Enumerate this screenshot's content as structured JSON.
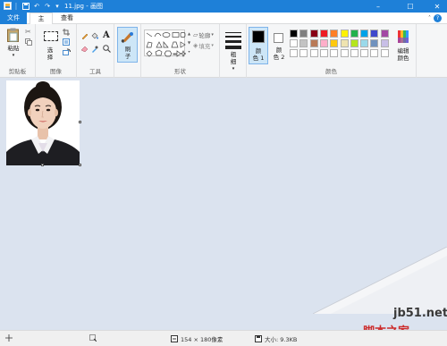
{
  "window": {
    "title": "11.jpg - 画图"
  },
  "tabs": {
    "file": "文件",
    "home": "主页",
    "view": "查看"
  },
  "ribbon": {
    "clipboard": {
      "paste_label": "粘贴",
      "group_label": "剪贴板"
    },
    "image": {
      "select_label_1": "选",
      "select_label_2": "择",
      "group_label": "图像"
    },
    "tools": {
      "text_tool_glyph": "A",
      "group_label": "工具"
    },
    "brushes": {
      "label_1": "刷",
      "label_2": "子"
    },
    "shapes": {
      "outline_label": "轮廓",
      "fill_label": "填充",
      "group_label": "形状"
    },
    "size": {
      "label_1": "粗",
      "label_2": "细"
    },
    "colors": {
      "color1_label_1": "颜",
      "color1_label_2": "色 1",
      "color2_label_1": "颜",
      "color2_label_2": "色 2",
      "edit_label_1": "编辑",
      "edit_label_2": "颜色",
      "group_label": "颜色",
      "color1": "#000000",
      "color2": "#ffffff",
      "palette_row1": [
        "#000000",
        "#7f7f7f",
        "#880015",
        "#ed1c24",
        "#ff7f27",
        "#fff200",
        "#22b14c",
        "#00a2e8",
        "#3f48cc",
        "#a349a4"
      ],
      "palette_row2": [
        "#ffffff",
        "#c3c3c3",
        "#b97a57",
        "#ffaec9",
        "#ffc90e",
        "#efe4b0",
        "#b5e61d",
        "#99d9ea",
        "#7092be",
        "#c8bfe7"
      ]
    }
  },
  "statusbar": {
    "dimensions": "154 × 180像素",
    "size": "大小: 9.3KB"
  },
  "watermark": {
    "url": "jb51.net",
    "site": "脚本之家"
  }
}
